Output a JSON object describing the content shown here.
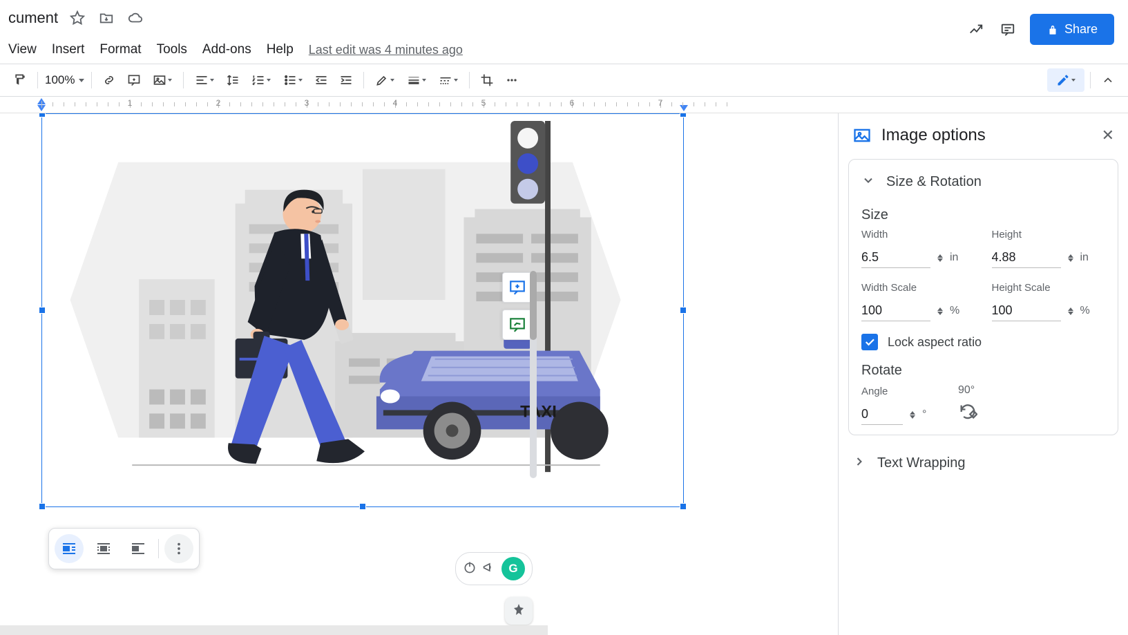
{
  "doc_title": "cument",
  "menus": {
    "view": "View",
    "insert": "Insert",
    "format": "Format",
    "tools": "Tools",
    "addons": "Add-ons",
    "help": "Help"
  },
  "last_edit": "Last edit was 4 minutes ago",
  "share_label": "Share",
  "zoom": "100%",
  "ruler_numbers": [
    "1",
    "2",
    "3",
    "4",
    "5",
    "6",
    "7"
  ],
  "panel": {
    "title": "Image options",
    "section_size_rot": "Size & Rotation",
    "size_heading": "Size",
    "width_label": "Width",
    "height_label": "Height",
    "width_val": "6.5",
    "height_val": "4.88",
    "in_unit": "in",
    "width_scale_label": "Width Scale",
    "height_scale_label": "Height Scale",
    "width_scale_val": "100",
    "height_scale_val": "100",
    "pct_unit": "%",
    "lock_label": "Lock aspect ratio",
    "rotate_heading": "Rotate",
    "angle_label": "Angle",
    "angle_val": "0",
    "deg_unit": "°",
    "ninety_label": "90°",
    "text_wrap": "Text Wrapping"
  },
  "illustration": {
    "taxi_label": "TAXI"
  }
}
